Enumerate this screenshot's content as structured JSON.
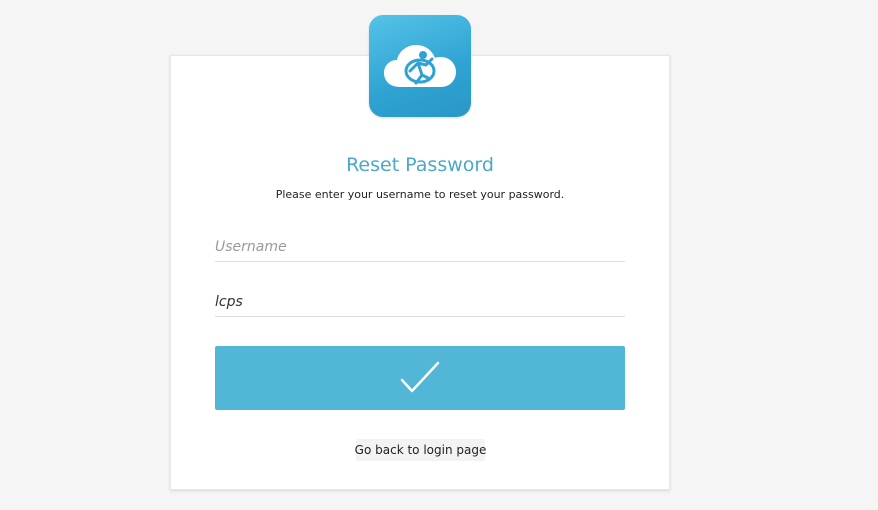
{
  "page": {
    "title": "Reset Password",
    "subtitle": "Please enter your username to reset your password."
  },
  "form": {
    "username_placeholder": "Username",
    "username_value": "",
    "second_field_value": "lcps",
    "submit_icon": "checkmark-icon"
  },
  "links": {
    "back_label": "Go back to login page"
  },
  "branding": {
    "logo_icon": "cloud-logo-icon",
    "accent_color": "#52b6d6",
    "title_color": "#4aa8c9"
  }
}
